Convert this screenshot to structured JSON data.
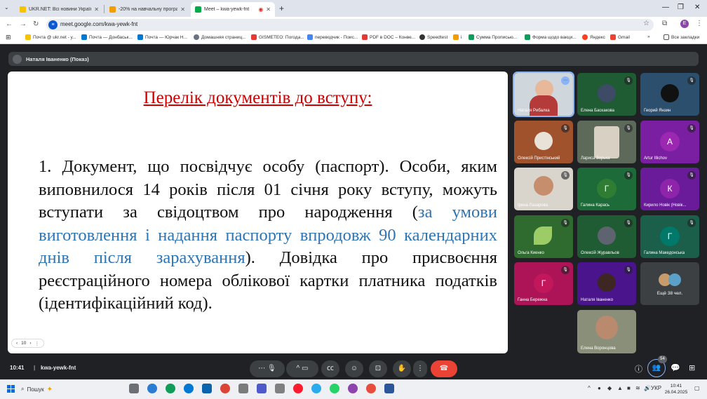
{
  "browser": {
    "tabs": [
      {
        "title": "UKR.NET: Всі новини України, ...",
        "active": false,
        "favicon_color": "#f5c400"
      },
      {
        "title": "-20% на навчальну програ...",
        "active": false,
        "favicon_color": "#f29d00"
      },
      {
        "title": "Meet – kwa-yewk-fnt",
        "active": true,
        "favicon_color": "#00ac47"
      }
    ],
    "new_tab_icon": "plus-icon",
    "url": "meet.google.com/kwa-yewk-fnt",
    "profile_initial": "E",
    "bookmarks": [
      "Почта @ ukr.net - у...",
      "Почта — Донбаськ...",
      "Почта — Юрчак Н...",
      "Домашняя страниц...",
      "GISMETEO: Погода...",
      "переводчик - Поис...",
      "PDF в DOC – Конве...",
      "Speedtest",
      "і",
      "Сумма Прописью...",
      "Форма щодо вакци...",
      "Яндекс",
      "Gmail"
    ],
    "all_bookmarks_label": "Все закладки"
  },
  "meet": {
    "presenter_label": "Наталя Іваненко (Показ)",
    "slide": {
      "title": "Перелік документів до вступу:",
      "body_before": "1. Документ, що посвідчує особу (паспорт). Особи, яким виповнилося 14 років після 01 січня року вступу, можуть вступати за свідоцтвом про народження (",
      "body_highlight": "за умови виготовлення і надання паспорту впродовж 90 календарних днів після зарахування",
      "body_after": "). Довідка про присвоєння реєстраційного номера облікової картки платника податків (ідентифікаційний код).",
      "highlight_color": "#2e75b6",
      "title_color": "#d00000",
      "page_number": "10"
    },
    "participants": [
      {
        "name": "Наталя Рибалка",
        "type": "video",
        "self": true
      },
      {
        "name": "Елена Баскакова",
        "type": "video",
        "muted": true
      },
      {
        "name": "Георий Янзин",
        "type": "video",
        "muted": true
      },
      {
        "name": "Олексій Пристінський",
        "type": "video",
        "muted": true
      },
      {
        "name": "Лариса Зорька",
        "type": "video",
        "muted": true
      },
      {
        "name": "Artur Illichov",
        "type": "letter",
        "letter": "A",
        "muted": true
      },
      {
        "name": "Ірина Лазарова",
        "type": "video",
        "muted": true
      },
      {
        "name": "Галина Карась",
        "type": "letter",
        "letter": "Г",
        "muted": true
      },
      {
        "name": "Кирило Новік (Новік...",
        "type": "letter",
        "letter": "К",
        "muted": true
      },
      {
        "name": "Ольга Киенко",
        "type": "video",
        "muted": true
      },
      {
        "name": "Олексій Журавльов",
        "type": "video",
        "muted": true
      },
      {
        "name": "Галина Македонська",
        "type": "letter",
        "letter": "Г",
        "muted": true
      },
      {
        "name": "Ганна Бережна",
        "type": "letter",
        "letter": "Г",
        "muted": true
      },
      {
        "name": "Наталя Іваненко",
        "type": "video",
        "muted": true
      },
      {
        "name": "Елена Воронцова",
        "type": "video"
      }
    ],
    "more_participants": "Ещё 38 чел.",
    "time": "10:41",
    "meeting_code": "kwa-yewk-fnt",
    "people_count": "54"
  },
  "taskbar": {
    "search_placeholder": "Пошук",
    "language": "УКР",
    "time": "10:41",
    "date": "26.04.2025"
  },
  "colors": {
    "meet_bg": "#202124",
    "control_bg": "#3c4043",
    "end_call": "#ea4335",
    "accent": "#8ab4f8"
  }
}
